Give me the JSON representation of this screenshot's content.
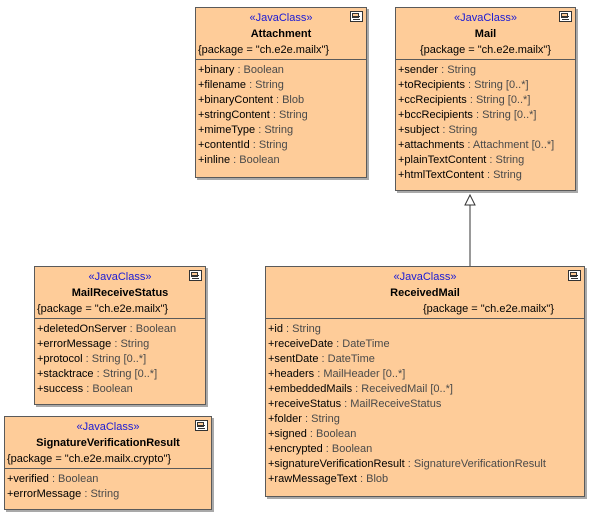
{
  "classes": {
    "attachment": {
      "stereotype": "«JavaClass»",
      "name": "Attachment",
      "package": "{package = \"ch.e2e.mailx\"}",
      "attributes": [
        {
          "name": "+binary",
          "type": " : Boolean"
        },
        {
          "name": "+filename",
          "type": " : String"
        },
        {
          "name": "+binaryContent",
          "type": " : Blob"
        },
        {
          "name": "+stringContent",
          "type": " : String"
        },
        {
          "name": "+mimeType",
          "type": " : String"
        },
        {
          "name": "+contentId",
          "type": " : String"
        },
        {
          "name": "+inline",
          "type": " : Boolean"
        }
      ]
    },
    "mail": {
      "stereotype": "«JavaClass»",
      "name": "Mail",
      "package": "{package = \"ch.e2e.mailx\"}",
      "attributes": [
        {
          "name": "+sender",
          "type": " : String"
        },
        {
          "name": "+toRecipients",
          "type": " : String [0..*]"
        },
        {
          "name": "+ccRecipients",
          "type": " : String [0..*]"
        },
        {
          "name": "+bccRecipients",
          "type": " : String [0..*]"
        },
        {
          "name": "+subject",
          "type": " : String"
        },
        {
          "name": "+attachments",
          "type": " : Attachment [0..*]"
        },
        {
          "name": "+plainTextContent",
          "type": " : String"
        },
        {
          "name": "+htmlTextContent",
          "type": " : String"
        }
      ]
    },
    "mailReceiveStatus": {
      "stereotype": "«JavaClass»",
      "name": "MailReceiveStatus",
      "package": "{package = \"ch.e2e.mailx\"}",
      "attributes": [
        {
          "name": "+deletedOnServer",
          "type": " : Boolean"
        },
        {
          "name": "+errorMessage",
          "type": " : String"
        },
        {
          "name": "+protocol",
          "type": " : String [0..*]"
        },
        {
          "name": "+stacktrace",
          "type": " : String [0..*]"
        },
        {
          "name": "+success",
          "type": " : Boolean"
        }
      ]
    },
    "signatureVerificationResult": {
      "stereotype": "«JavaClass»",
      "name": "SignatureVerificationResult",
      "package": "{package = \"ch.e2e.mailx.crypto\"}",
      "attributes": [
        {
          "name": "+verified",
          "type": " : Boolean"
        },
        {
          "name": "+errorMessage",
          "type": " : String"
        }
      ]
    },
    "receivedMail": {
      "stereotype": "«JavaClass»",
      "name": "ReceivedMail",
      "package": "{package = \"ch.e2e.mailx\"}",
      "attributes": [
        {
          "name": "+id",
          "type": " : String"
        },
        {
          "name": "+receiveDate",
          "type": " : DateTime"
        },
        {
          "name": "+sentDate",
          "type": " : DateTime"
        },
        {
          "name": "+headers",
          "type": " : MailHeader [0..*]"
        },
        {
          "name": "+embeddedMails",
          "type": " : ReceivedMail [0..*]"
        },
        {
          "name": "+receiveStatus",
          "type": " : MailReceiveStatus"
        },
        {
          "name": "+folder",
          "type": " : String"
        },
        {
          "name": "+signed",
          "type": " : Boolean"
        },
        {
          "name": "+encrypted",
          "type": " : Boolean"
        },
        {
          "name": "+signatureVerificationResult",
          "type": " : SignatureVerificationResult"
        },
        {
          "name": "+rawMessageText",
          "type": " : Blob"
        }
      ]
    }
  },
  "colors": {
    "class_fill": "#fecc99",
    "stereotype_text": "#1a1ad6",
    "border": "#5a5a5a"
  },
  "icons": {
    "class_corner": "class-diagram-icon"
  }
}
